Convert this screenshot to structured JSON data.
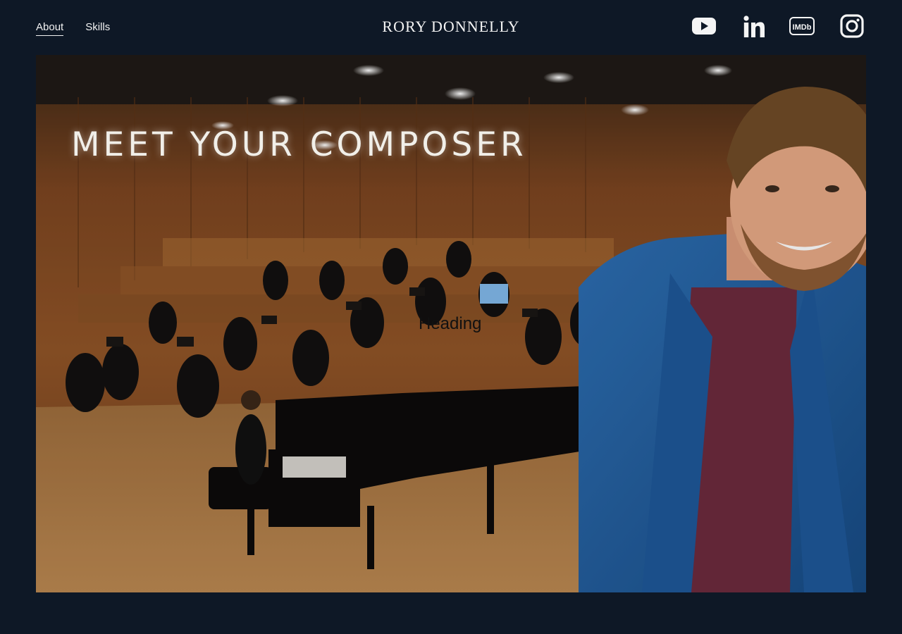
{
  "nav": {
    "items": [
      {
        "label": "About",
        "active": true
      },
      {
        "label": "Skills",
        "active": false
      }
    ]
  },
  "brand": {
    "name": "RORY DONNELLY"
  },
  "social": {
    "icons": [
      "youtube-icon",
      "linkedin-icon",
      "imdb-icon",
      "instagram-icon"
    ],
    "imdb_text": "IMDb"
  },
  "hero": {
    "title": "MEET YOUR COMPOSER",
    "heading": "Heading"
  },
  "colors": {
    "background": "#0e1826",
    "text": "#f2f2f2"
  }
}
